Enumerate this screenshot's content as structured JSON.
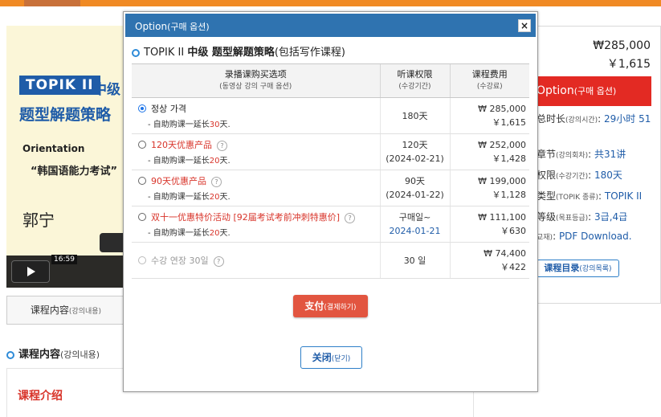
{
  "bg": {
    "video": {
      "badge": "TOPIK II",
      "badge_suffix": "中级",
      "title_line": "题型解题策略",
      "orientation": "Orientation",
      "quote": "“韩国语能力考试”",
      "teacher": "郭宁",
      "time": "16:59"
    },
    "tab": {
      "label": "课程内容",
      "sub": "(강의내용)"
    },
    "section": {
      "label": "课程内容",
      "sub": "(강의내용)"
    },
    "intro": "课程介绍",
    "right": {
      "price_krw": "₩285,000",
      "price_cny": "￥1,615",
      "option_label": "Option",
      "option_sub": "(구매 옵션)",
      "lines": [
        {
          "label": "总时长",
          "sub": "(강의시간)",
          "value": "29小时 51"
        },
        {
          "label": "章节",
          "sub": "(강의회차)",
          "value": "共31讲"
        },
        {
          "label": "权限",
          "sub": "(수강기간)",
          "value": "180天"
        },
        {
          "label": "类型",
          "sub": "(TOPIK 종류)",
          "value": "TOPIK II"
        },
        {
          "label": "等级",
          "sub": "(목표등급)",
          "value": "3급,4급"
        },
        {
          "label": "",
          "sub": "교재)",
          "value": "PDF Download."
        }
      ],
      "catalog_label": "课程目录",
      "catalog_sub": "(강의목록)"
    }
  },
  "modal": {
    "title": "Option",
    "title_sub": "(구매 옵션)",
    "close_glyph": "×",
    "course_prefix": "TOPIK II",
    "course_bold": "中级 题型解题策略",
    "course_rest": "(包括写作课程)",
    "columns": [
      {
        "label": "录播课购买选项",
        "sub": "(동영상 강의 구매 옵션)"
      },
      {
        "label": "听课权限",
        "sub": "(수강기간)"
      },
      {
        "label": "课程费用",
        "sub": "(수강료)"
      }
    ],
    "rows": [
      {
        "name": "정상 가격",
        "sub_pre": "- 自助购课一延长",
        "sub_hl": "30",
        "sub_post": "天.",
        "period": "180天",
        "date": "",
        "krw": "₩ 285,000",
        "cny": "￥1,615"
      },
      {
        "name": "120天优惠产品",
        "sub_pre": "- 自助购课一延长",
        "sub_hl": "20",
        "sub_post": "天.",
        "period": "120天",
        "date": "(2024-02-21)",
        "krw": "₩ 252,000",
        "cny": "￥1,428"
      },
      {
        "name": "90天优惠产品",
        "sub_pre": "- 自助购课一延长",
        "sub_hl": "20",
        "sub_post": "天.",
        "period": "90天",
        "date": "(2024-01-22)",
        "krw": "₩ 199,000",
        "cny": "￥1,128"
      },
      {
        "name": "双十一优惠特价活动 [92届考试考前冲刺特惠价]",
        "sub_pre": "- 自助购课一延长",
        "sub_hl": "20",
        "sub_post": "天.",
        "period": "구매일~",
        "date": "2024-01-21",
        "krw": "₩ 111,100",
        "cny": "￥630"
      },
      {
        "name": "수강 연장 30일",
        "sub_pre": "",
        "sub_hl": "",
        "sub_post": "",
        "period": "30 일",
        "date": "",
        "krw": "₩ 74,400",
        "cny": "￥422"
      }
    ],
    "selected_row": 0,
    "help_glyph": "?",
    "pay_label": "支付",
    "pay_sub": "(결제하기)",
    "close_label": "关闭",
    "close_sub": "(닫기)"
  }
}
